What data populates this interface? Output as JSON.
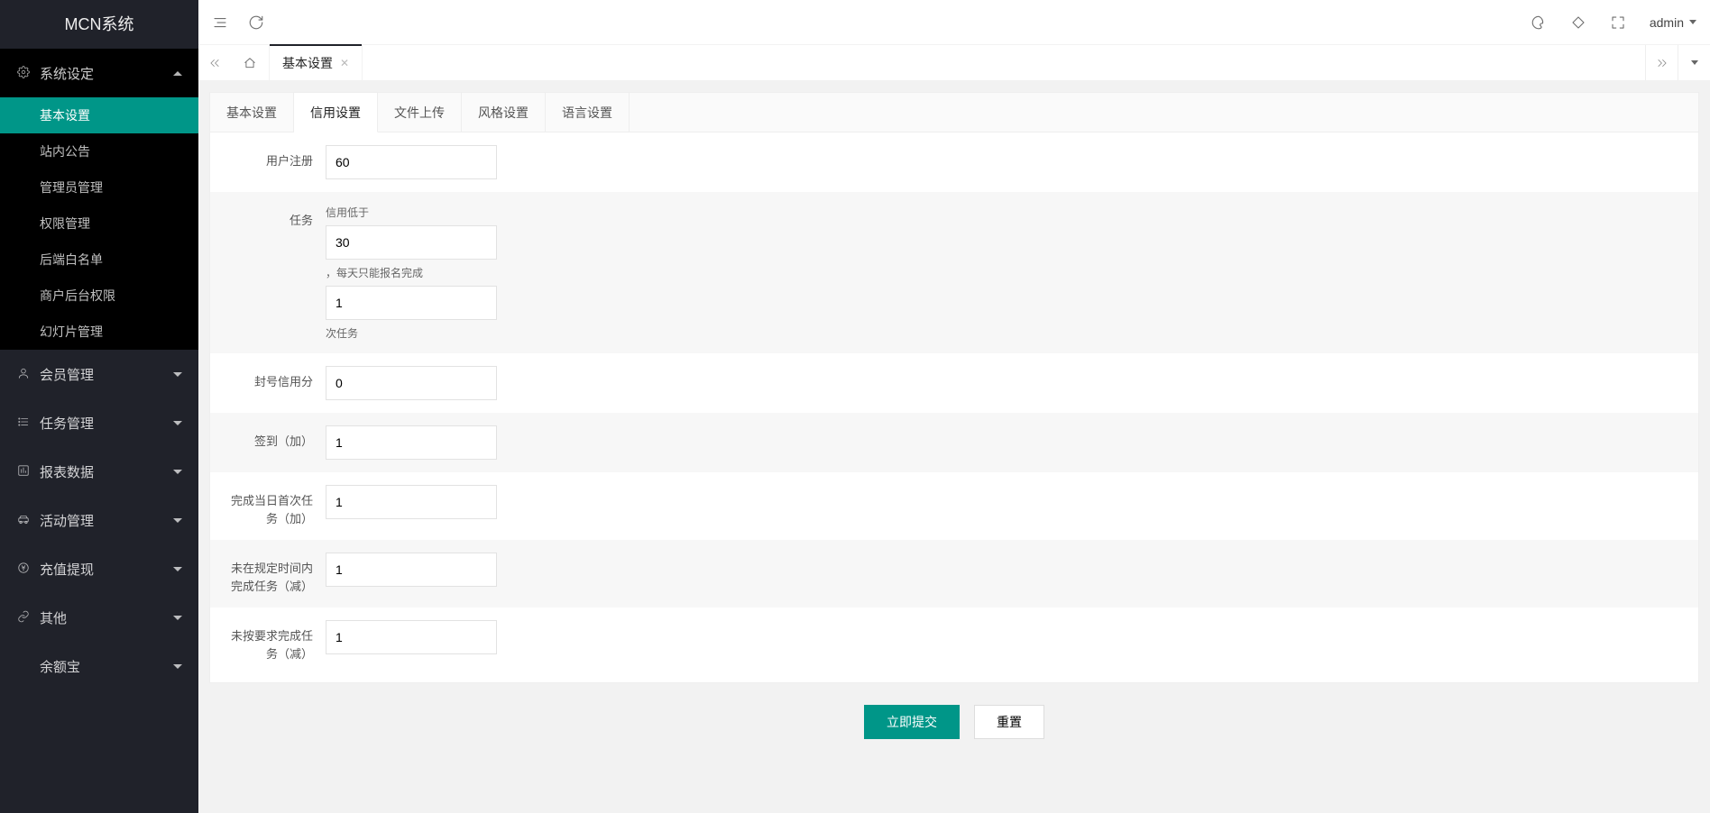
{
  "app": {
    "title": "MCN系统"
  },
  "topbar": {
    "user": "admin"
  },
  "sidebar": {
    "groups": [
      {
        "label": "系统设定",
        "open": true,
        "items": [
          {
            "label": "基本设置",
            "active": true
          },
          {
            "label": "站内公告"
          },
          {
            "label": "管理员管理"
          },
          {
            "label": "权限管理"
          },
          {
            "label": "后端白名单"
          },
          {
            "label": "商户后台权限"
          },
          {
            "label": "幻灯片管理"
          }
        ]
      },
      {
        "label": "会员管理",
        "open": false
      },
      {
        "label": "任务管理",
        "open": false
      },
      {
        "label": "报表数据",
        "open": false
      },
      {
        "label": "活动管理",
        "open": false
      },
      {
        "label": "充值提现",
        "open": false
      },
      {
        "label": "其他",
        "open": false
      },
      {
        "label": "余额宝",
        "open": false
      }
    ]
  },
  "page_tabs": {
    "items": [
      {
        "label": "基本设置",
        "active": true,
        "closable": true
      }
    ]
  },
  "inner_tabs": {
    "items": [
      {
        "label": "基本设置"
      },
      {
        "label": "信用设置",
        "active": true
      },
      {
        "label": "文件上传"
      },
      {
        "label": "风格设置"
      },
      {
        "label": "语言设置"
      }
    ]
  },
  "form": {
    "rows": {
      "user_register": {
        "label": "用户注册",
        "value": "60"
      },
      "task": {
        "label": "任务",
        "hint1": "信用低于",
        "value1": "30",
        "hint2": "，每天只能报名完成",
        "value2": "1",
        "hint3": "次任务"
      },
      "ban_score": {
        "label": "封号信用分",
        "value": "0"
      },
      "checkin_add": {
        "label": "签到（加）",
        "value": "1"
      },
      "first_task_add": {
        "label": "完成当日首次任务（加）",
        "value": "1"
      },
      "overtime_sub": {
        "label": "未在规定时间内完成任务（减）",
        "value": "1"
      },
      "not_required_sub": {
        "label": "未按要求完成任务（减）",
        "value": "1"
      }
    }
  },
  "buttons": {
    "submit": "立即提交",
    "reset": "重置"
  }
}
